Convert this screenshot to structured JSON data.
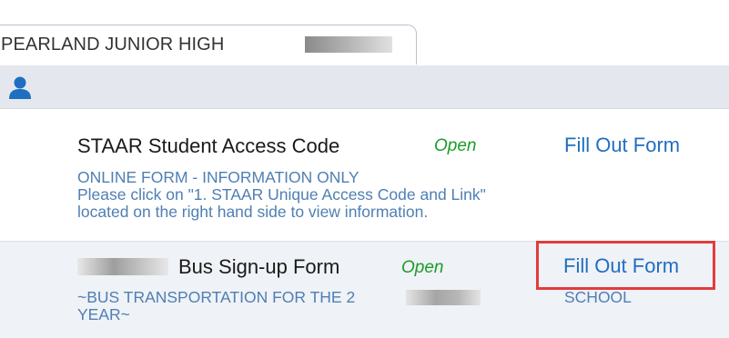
{
  "school_tab": {
    "label": "PEARLAND JUNIOR HIGH"
  },
  "header": {
    "icon": "person-icon"
  },
  "forms": [
    {
      "title": "STAAR Student Access Code",
      "status": "Open",
      "action": "Fill Out Form",
      "description": [
        "ONLINE FORM - INFORMATION ONLY",
        "Please click on \"1. STAAR Unique Access Code and Link\"",
        "located on the right hand side to view information."
      ]
    },
    {
      "title": "Bus Sign-up Form",
      "status": "Open",
      "action": "Fill Out Form",
      "description": [
        "~BUS TRANSPORTATION FOR THE 2",
        "SCHOOL",
        "YEAR~"
      ]
    }
  ],
  "colors": {
    "status_open": "#1c9c28",
    "link": "#1f6fc0",
    "description": "#4f7fb3",
    "highlight": "#e43b3b"
  }
}
